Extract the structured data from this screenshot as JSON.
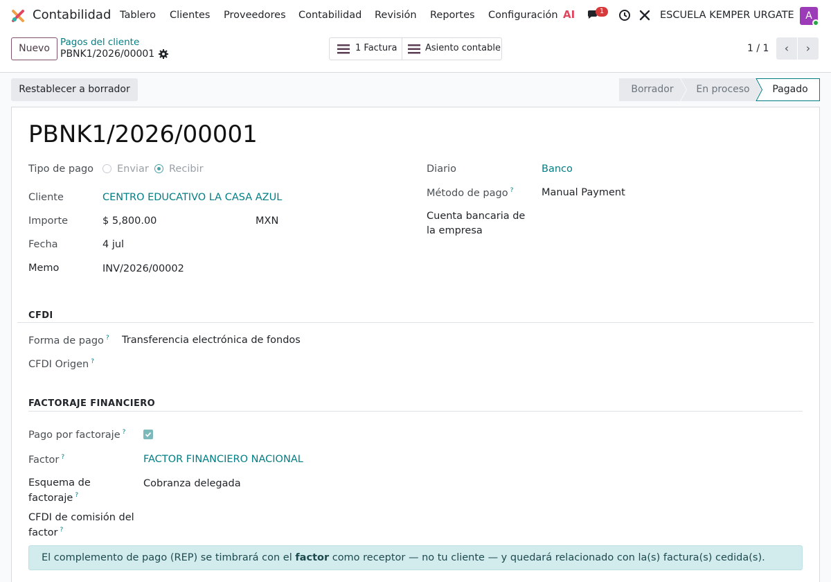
{
  "navbar": {
    "app_name": "Contabilidad",
    "menu": [
      "Tablero",
      "Clientes",
      "Proveedores",
      "Contabilidad",
      "Revisión",
      "Reportes",
      "Configuración"
    ],
    "ai_label": "AI",
    "chat_count": "1",
    "company": "ESCUELA KEMPER URGATE",
    "avatar_initial": "A"
  },
  "control": {
    "new_label": "Nuevo",
    "breadcrumb_parent": "Pagos del cliente",
    "breadcrumb_current": "PBNK1/2026/00001",
    "smart_buttons": [
      "1 Factura",
      "Asiento contable"
    ],
    "pager": "1 / 1"
  },
  "actions": {
    "reset_label": "Restablecer a borrador",
    "stages": [
      "Borrador",
      "En proceso",
      "Pagado"
    ],
    "active_stage": "Pagado"
  },
  "form": {
    "title": "PBNK1/2026/00001",
    "payment_type": {
      "label": "Tipo de pago",
      "options": [
        "Enviar",
        "Recibir"
      ],
      "selected": "Recibir"
    },
    "customer": {
      "label": "Cliente",
      "value": "CENTRO EDUCATIVO LA CASA AZUL"
    },
    "amount": {
      "label": "Importe",
      "value": "$ 5,800.00",
      "currency": "MXN"
    },
    "date": {
      "label": "Fecha",
      "value": "4 jul"
    },
    "memo": {
      "label": "Memo",
      "value": "INV/2026/00002"
    },
    "journal": {
      "label": "Diario",
      "value": "Banco"
    },
    "method": {
      "label": "Método de pago",
      "value": "Manual Payment"
    },
    "bank_account": {
      "label_line1": "Cuenta bancaria de",
      "label_line2": "la empresa"
    }
  },
  "cfdi": {
    "heading": "CFDI",
    "forma_pago": {
      "label": "Forma de pago",
      "value": "Transferencia electrónica de fondos"
    },
    "origen": {
      "label": "CFDI Origen"
    }
  },
  "factoraje": {
    "heading": "FACTORAJE FINANCIERO",
    "pago_factoraje": {
      "label": "Pago por factoraje",
      "checked": true
    },
    "factor": {
      "label": "Factor",
      "value": "FACTOR FINANCIERO NACIONAL"
    },
    "esquema": {
      "label_line1": "Esquema de",
      "label_line2": "factoraje",
      "value": "Cobranza delegada"
    },
    "comision": {
      "label_line1": "CFDI de comisión del",
      "label_line2": "factor"
    }
  },
  "alert": {
    "before": "El complemento de pago (REP) se timbrará con el ",
    "bold": "factor",
    "after": " como receptor — no tu cliente — y quedará relacionado con la(s) factura(s) cedida(s)."
  },
  "colors": {
    "accent_teal": "#017e84",
    "brand_primary": "#714b67",
    "active_stage_border": "#017e84",
    "alert_bg": "#d2ebed",
    "badge_red": "#d63a3a"
  },
  "icons": [
    "app-logo-icon",
    "chat-icon",
    "clock-icon",
    "tools-icon",
    "gear-icon",
    "list-icon",
    "chevron-left-icon",
    "chevron-right-icon",
    "checkbox-icon"
  ]
}
